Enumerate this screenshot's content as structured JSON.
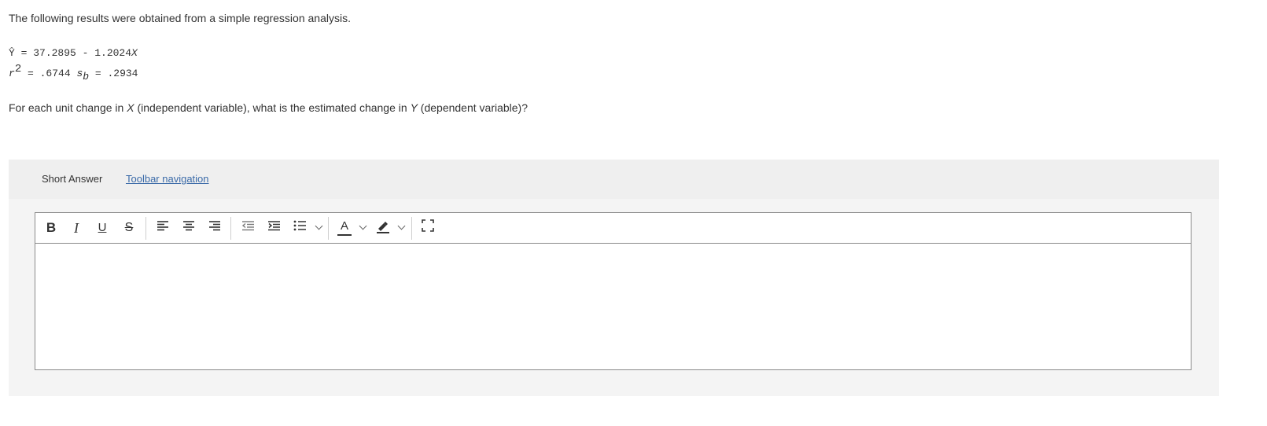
{
  "intro_text": "The following results were obtained from a simple regression analysis.",
  "equation": {
    "yhat": "Ŷ",
    "eq": " = 37.2895 - 1.2024",
    "x": "X"
  },
  "stats": {
    "r": "r",
    "r_exp": "2",
    "r2_value": " = .6744 ",
    "sb": "s",
    "sb_sub": "b",
    "sb_value": " = .2934"
  },
  "question": {
    "part1": "For each unit change in ",
    "x": "X",
    "part2": " (independent variable), what is the estimated change in ",
    "y": "Y",
    "part3": " (dependent variable)?"
  },
  "answer_panel": {
    "label": "Short Answer",
    "toolbar_link": "Toolbar navigation "
  },
  "toolbar": {
    "bold": "B",
    "italic": "I",
    "underline": "U",
    "strike": "S",
    "font_color_letter": "A"
  },
  "colors": {
    "link": "#3a6aa8",
    "panel_bg": "#f4f4f4",
    "editor_border": "#8a8a8a"
  }
}
